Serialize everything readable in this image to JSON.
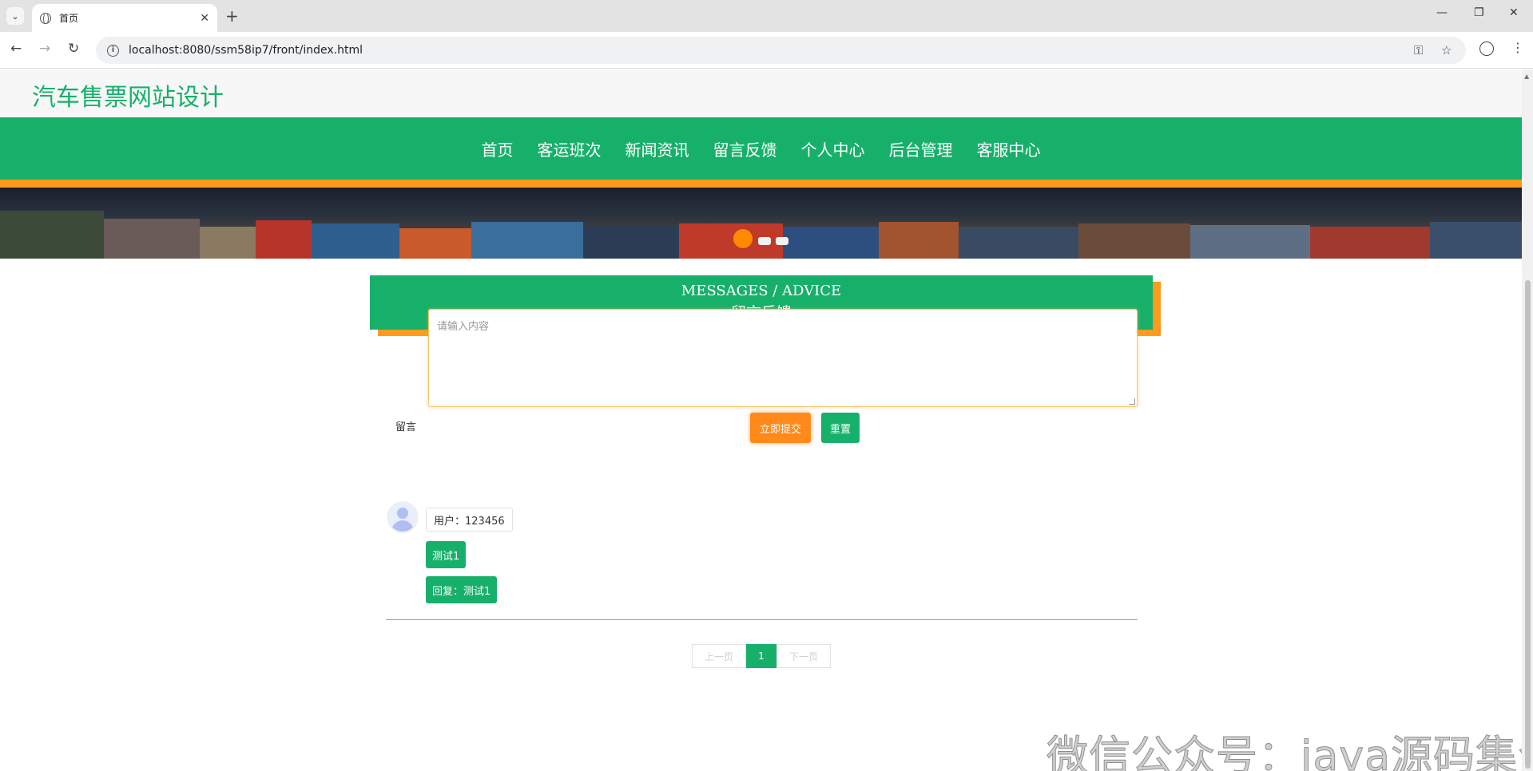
{
  "browser": {
    "tab_title": "首页",
    "url": "localhost:8080/ssm58ip7/front/index.html"
  },
  "site": {
    "title": "汽车售票网站设计"
  },
  "nav": {
    "items": [
      "首页",
      "客运班次",
      "新闻资讯",
      "留言反馈",
      "个人中心",
      "后台管理",
      "客服中心"
    ]
  },
  "banner": {
    "active_slide": 1,
    "slide_count": 3
  },
  "section": {
    "title_en": "MESSAGES / ADVICE",
    "title_cn": "留言反馈"
  },
  "form": {
    "label": "留言",
    "placeholder": "请输入内容",
    "value": "",
    "submit_label": "立即提交",
    "reset_label": "重置"
  },
  "messages": [
    {
      "user": "用户：123456",
      "content": "测试1",
      "reply": "回复：测试1"
    }
  ],
  "pagination": {
    "prev": "上一页",
    "current": "1",
    "next": "下一页"
  },
  "watermark": "微信公众号：java源码集合",
  "colors": {
    "primary": "#17b06b",
    "accent": "#ff9a1c"
  },
  "icons": {
    "back": "arrow-left-icon",
    "forward": "arrow-right-icon",
    "reload": "reload-icon",
    "info": "info-icon",
    "key": "key-icon",
    "star": "star-icon",
    "profile": "profile-icon",
    "more": "more-icon"
  }
}
